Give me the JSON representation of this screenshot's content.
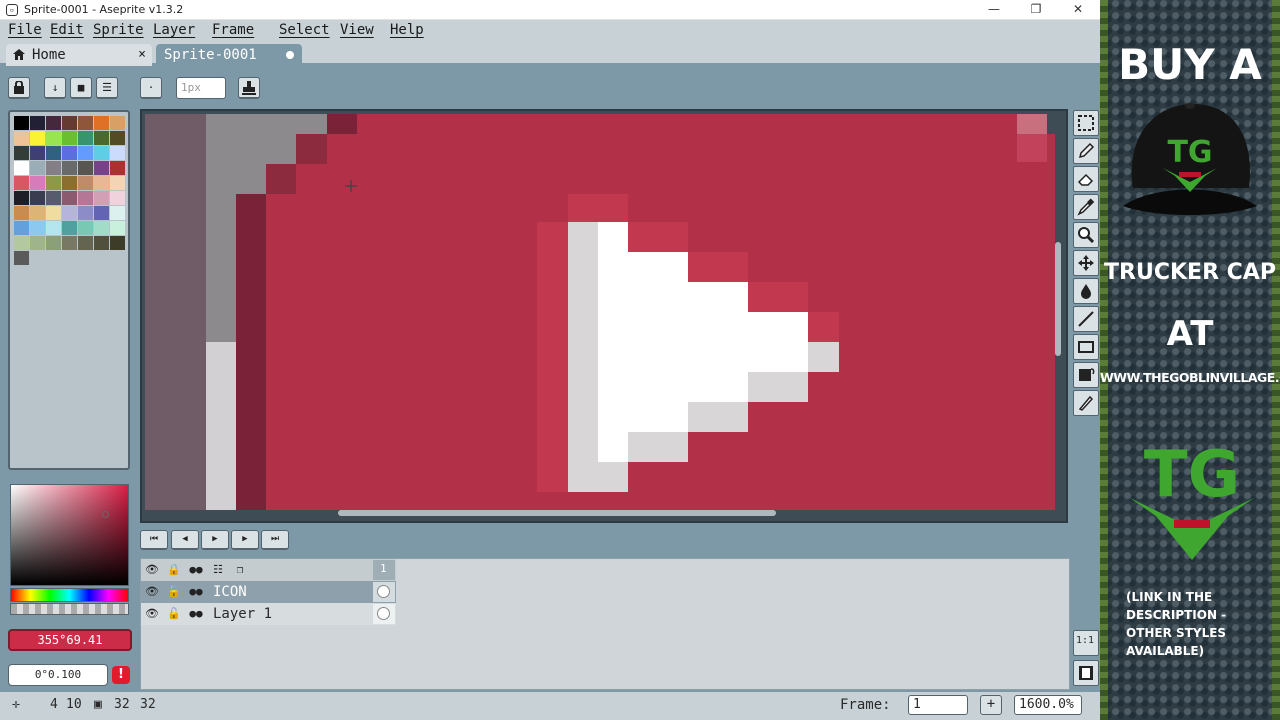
{
  "window": {
    "title": "Sprite-0001 - Aseprite v1.3.2",
    "minimize_glyph": "—",
    "restore_glyph": "❐",
    "close_glyph": "✕"
  },
  "menu": [
    "File",
    "Edit",
    "Sprite",
    "Layer",
    "Frame",
    "Select",
    "View",
    "Help"
  ],
  "tabs": {
    "home_label": "Home",
    "home_close": "×",
    "sprite_label": "Sprite-0001"
  },
  "tool_options": {
    "brush_size_placeholder": "1px"
  },
  "colors": {
    "primary": "#cc2c48",
    "canvas_red": "#b03048",
    "accent_red": "#cc2c48"
  },
  "color_bar": {
    "color_value": "355°69.41",
    "angle_value": "0°0.100",
    "warning_glyph": "!"
  },
  "timeline": {
    "frame_header": "1",
    "layers": [
      {
        "name": "ICON",
        "selected": true
      },
      {
        "name": "Layer 1",
        "selected": false
      }
    ]
  },
  "status": {
    "pos_x": "4",
    "pos_y": "10",
    "size_w": "32",
    "size_h": "32",
    "frame_label": "Frame:",
    "frame_value": "1",
    "add_glyph": "+",
    "zoom_value": "1600.0%"
  },
  "side_buttons": {
    "ratio_label": "1:1"
  },
  "ad": {
    "line1": "BUY A",
    "line2": "TRUCKER CAP",
    "line3": "AT",
    "url": "WWW.THEGOBLINVILLAGE.COM",
    "logo_text": "TG",
    "footnote": "(LINK IN THE DESCRIPTION - OTHER STYLES AVAILABLE)"
  }
}
